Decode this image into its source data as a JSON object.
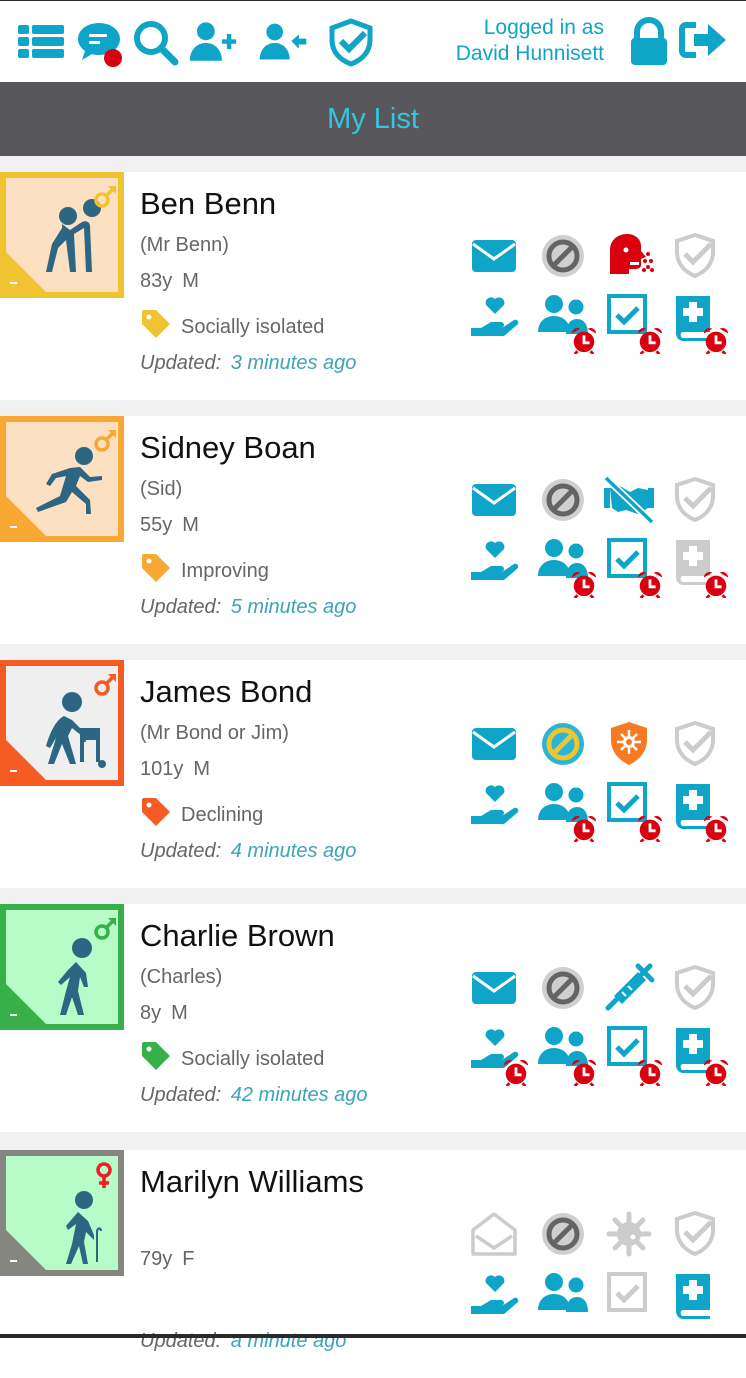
{
  "app": {
    "toolbar": {
      "icons": [
        "list-icon",
        "chat-icon",
        "search-icon",
        "add-user-icon",
        "assign-user-icon",
        "shield-check-icon"
      ],
      "chat_has_notification": true,
      "login_line1": "Logged in as",
      "login_line2": "David Hunnisett",
      "right_icons": [
        "lock-icon",
        "logout-icon"
      ]
    },
    "title": "My List",
    "colors": {
      "accent": "#0fa5c9",
      "title": "#35c5e0",
      "titlebar_bg": "#58575c",
      "alarm": "#d9000f",
      "inactive": "#cccccc"
    }
  },
  "patients": [
    {
      "name": "Ben Benn",
      "nickname": "(Mr Benn)",
      "age": "83y",
      "sex": "M",
      "tag": "Socially isolated",
      "tag_color": "#f0c330",
      "updated_label": "Updated:",
      "updated": "3 minutes ago",
      "avatar": {
        "figure": "helping-person",
        "border": "#f0c330",
        "bg": "#fddfc1",
        "sex_color": "#f0c330",
        "sex_symbol": "male"
      },
      "status_icons": [
        {
          "name": "message",
          "state": "active"
        },
        {
          "name": "blocked",
          "state": "grey"
        },
        {
          "name": "coughing",
          "state": "alert-red"
        },
        {
          "name": "shield-check",
          "state": "inactive"
        },
        {
          "name": "care",
          "state": "active",
          "alarm": false
        },
        {
          "name": "contacts",
          "state": "active",
          "alarm": true
        },
        {
          "name": "tasks",
          "state": "active",
          "alarm": true
        },
        {
          "name": "medical-record",
          "state": "active",
          "alarm": true
        }
      ]
    },
    {
      "name": "Sidney Boan",
      "nickname": "(Sid)",
      "age": "55y",
      "sex": "M",
      "tag": "Improving",
      "tag_color": "#f7a933",
      "updated_label": "Updated:",
      "updated": "5 minutes ago",
      "avatar": {
        "figure": "running-person",
        "border": "#f7a933",
        "bg": "#fddfc1",
        "sex_color": "#f7a933",
        "sex_symbol": "male"
      },
      "status_icons": [
        {
          "name": "message",
          "state": "active"
        },
        {
          "name": "blocked",
          "state": "grey"
        },
        {
          "name": "no-handshake",
          "state": "active"
        },
        {
          "name": "shield-check",
          "state": "inactive"
        },
        {
          "name": "care",
          "state": "active",
          "alarm": false
        },
        {
          "name": "contacts",
          "state": "active",
          "alarm": true
        },
        {
          "name": "tasks",
          "state": "active",
          "alarm": true
        },
        {
          "name": "medical-record",
          "state": "inactive",
          "alarm": true
        }
      ]
    },
    {
      "name": "James Bond",
      "nickname": "(Mr Bond or Jim)",
      "age": "101y",
      "sex": "M",
      "tag": "Declining",
      "tag_color": "#f55b22",
      "updated_label": "Updated:",
      "updated": "4 minutes ago",
      "avatar": {
        "figure": "walker-person",
        "border": "#f55b22",
        "bg": "#efefef",
        "sex_color": "#f55b22",
        "sex_symbol": "male"
      },
      "status_icons": [
        {
          "name": "message",
          "state": "active"
        },
        {
          "name": "blocked",
          "state": "warning-yellow"
        },
        {
          "name": "virus-shield",
          "state": "alert-orange"
        },
        {
          "name": "shield-check",
          "state": "inactive"
        },
        {
          "name": "care",
          "state": "active",
          "alarm": false
        },
        {
          "name": "contacts",
          "state": "active",
          "alarm": true
        },
        {
          "name": "tasks",
          "state": "active",
          "alarm": true
        },
        {
          "name": "medical-record",
          "state": "active",
          "alarm": true
        }
      ]
    },
    {
      "name": "Charlie Brown",
      "nickname": "(Charles)",
      "age": "8y",
      "sex": "M",
      "tag": "Socially isolated",
      "tag_color": "#38b04a",
      "updated_label": "Updated:",
      "updated": "42 minutes ago",
      "avatar": {
        "figure": "walking-person",
        "border": "#38b04a",
        "bg": "#b7fbc9",
        "sex_color": "#38b04a",
        "sex_symbol": "male"
      },
      "status_icons": [
        {
          "name": "message",
          "state": "active"
        },
        {
          "name": "blocked",
          "state": "grey"
        },
        {
          "name": "syringe",
          "state": "active"
        },
        {
          "name": "shield-check",
          "state": "inactive"
        },
        {
          "name": "care",
          "state": "active",
          "alarm": true
        },
        {
          "name": "contacts",
          "state": "active",
          "alarm": true
        },
        {
          "name": "tasks",
          "state": "active",
          "alarm": true
        },
        {
          "name": "medical-record",
          "state": "active",
          "alarm": true
        }
      ]
    },
    {
      "name": "Marilyn Williams",
      "nickname": "",
      "age": "79y",
      "sex": "F",
      "tag": "",
      "tag_color": "",
      "updated_label": "Updated:",
      "updated": "a minute ago",
      "avatar": {
        "figure": "cane-person",
        "border": "#868681",
        "bg": "#b7fbc9",
        "sex_color": "#ee1c24",
        "sex_symbol": "female"
      },
      "status_icons": [
        {
          "name": "message-open",
          "state": "inactive"
        },
        {
          "name": "blocked",
          "state": "grey"
        },
        {
          "name": "virus",
          "state": "inactive"
        },
        {
          "name": "shield-check",
          "state": "inactive"
        },
        {
          "name": "care",
          "state": "active",
          "alarm": false
        },
        {
          "name": "contacts",
          "state": "active",
          "alarm": false
        },
        {
          "name": "tasks",
          "state": "inactive",
          "alarm": false
        },
        {
          "name": "medical-record",
          "state": "active",
          "alarm": false
        }
      ]
    }
  ]
}
